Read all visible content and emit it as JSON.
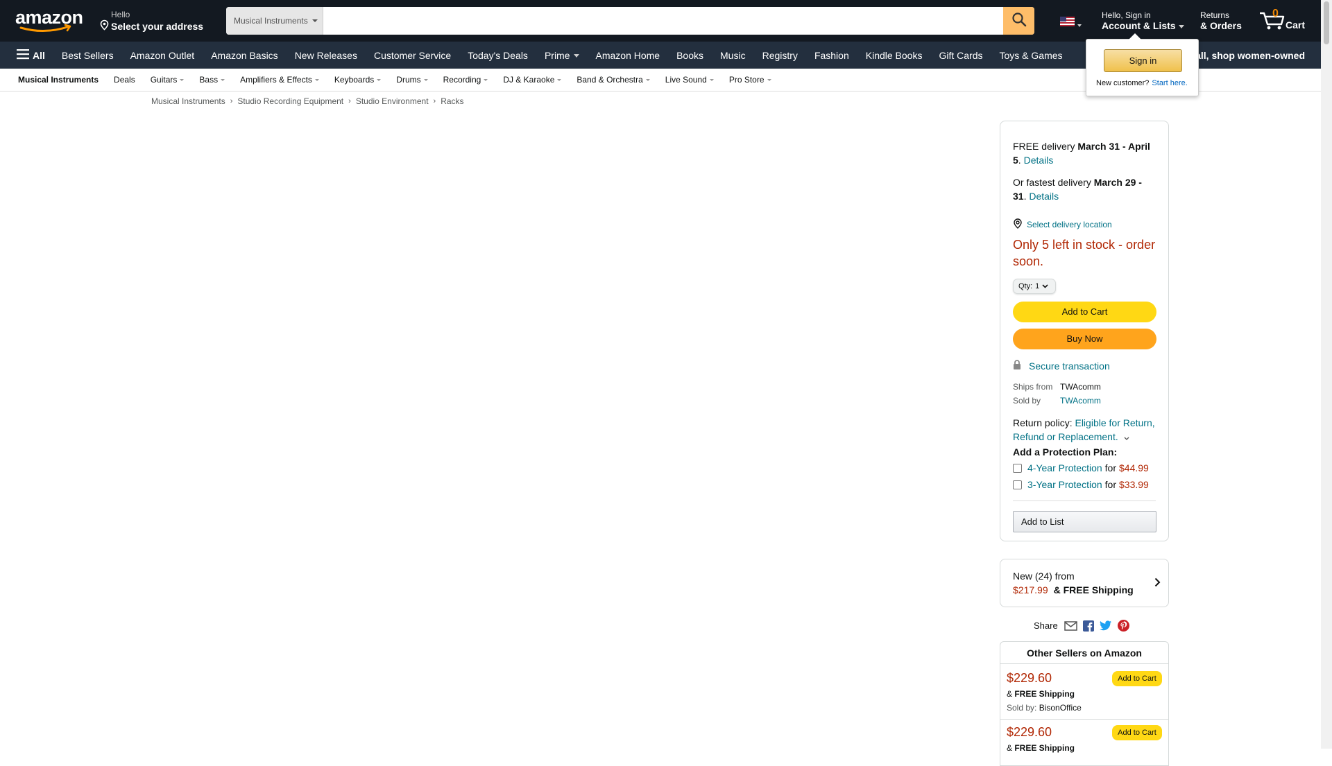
{
  "header": {
    "address_greeting": "Hello",
    "address_label": "Select your address",
    "search_category": "Musical Instruments",
    "search_placeholder": "",
    "account_greeting": "Hello, Sign in",
    "account_label": "Account & Lists",
    "returns_small": "Returns",
    "returns_big": "& Orders",
    "cart_count": "0",
    "cart_label": "Cart"
  },
  "nav": {
    "all_label": "All",
    "items": [
      "Best Sellers",
      "Amazon Outlet",
      "Amazon Basics",
      "New Releases",
      "Customer Service",
      "Today's Deals",
      "Prime",
      "Amazon Home",
      "Books",
      "Music",
      "Registry",
      "Fashion",
      "Kindle Books",
      "Gift Cards",
      "Toys & Games"
    ],
    "promo": "all, shop women-owned"
  },
  "subnav": {
    "items": [
      "Musical Instruments",
      "Deals",
      "Guitars",
      "Bass",
      "Amplifiers & Effects",
      "Keyboards",
      "Drums",
      "Recording",
      "DJ & Karaoke",
      "Band & Orchestra",
      "Live Sound",
      "Pro Store"
    ]
  },
  "breadcrumb": [
    "Musical Instruments",
    "Studio Recording Equipment",
    "Studio Environment",
    "Racks"
  ],
  "flyout": {
    "sign_in": "Sign in",
    "new_customer": "New customer?",
    "start_here": "Start here."
  },
  "buybox": {
    "free_delivery_prefix": "FREE delivery ",
    "free_delivery_dates": "March 31 - April 5",
    "details": "Details",
    "fastest_prefix": "Or fastest delivery ",
    "fastest_dates": "March 29 - 31",
    "select_location": "Select delivery location",
    "stock": "Only 5 left in stock - order soon.",
    "qty_label": "Qty:",
    "qty_value": "1",
    "add_to_cart": "Add to Cart",
    "buy_now": "Buy Now",
    "secure": "Secure transaction",
    "ships_from_label": "Ships from",
    "ships_from": "TWAcomm",
    "sold_by_label": "Sold by",
    "sold_by": "TWAcomm",
    "return_label": "Return policy: ",
    "return_link": "Eligible for Return, Refund or Replacement.",
    "protection_title": "Add a Protection Plan:",
    "protection": [
      {
        "name": "4-Year Protection",
        "for": "for",
        "price": "$44.99"
      },
      {
        "name": "3-Year Protection",
        "for": "for",
        "price": "$33.99"
      }
    ],
    "add_to_list": "Add to List"
  },
  "new_offers": {
    "line1": "New (24) from",
    "price": "$217.99",
    "shipping": "& FREE Shipping"
  },
  "share": {
    "label": "Share"
  },
  "other_sellers": {
    "title": "Other Sellers on Amazon",
    "offers": [
      {
        "price": "$229.60",
        "ship_prefix": "& ",
        "ship": "FREE Shipping",
        "sold_label": "Sold by: ",
        "seller": "BisonOffice",
        "button": "Add to Cart"
      },
      {
        "price": "$229.60",
        "ship_prefix": "& ",
        "ship": "FREE Shipping",
        "sold_label": "",
        "seller": "",
        "button": "Add to Cart"
      }
    ]
  },
  "colors": {
    "nav_dark": "#131921",
    "nav_secondary": "#232f3e",
    "search_button": "#febd69",
    "price_red": "#b12704",
    "link_teal": "#007185",
    "add_to_cart": "#ffd814",
    "buy_now": "#ffa41c"
  }
}
